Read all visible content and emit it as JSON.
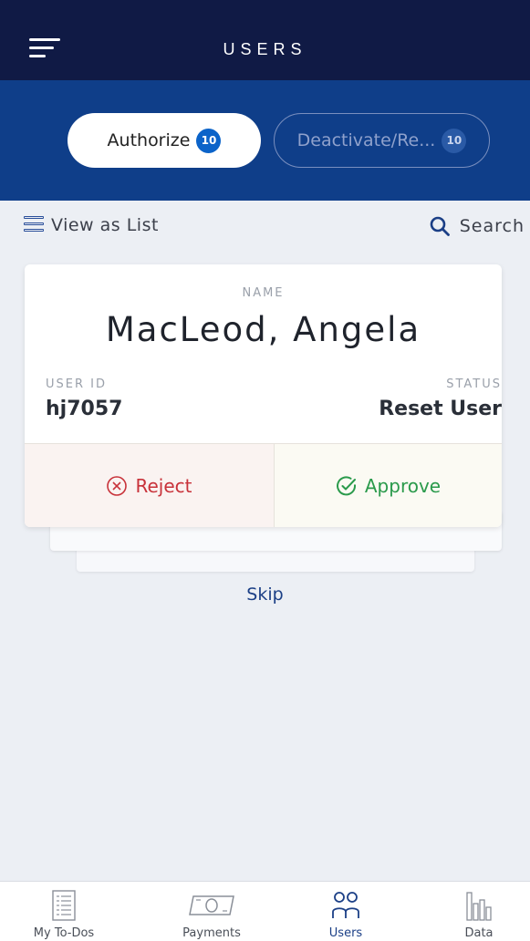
{
  "header": {
    "title": "USERS"
  },
  "tabs": [
    {
      "label": "Authorize",
      "count": "10"
    },
    {
      "label": "Deactivate/Re...",
      "count": "10"
    }
  ],
  "toolbar": {
    "view_label": "View as List",
    "search_label": "Search"
  },
  "card": {
    "name_label": "NAME",
    "name_value": "MacLeod, Angela",
    "userid_label": "USER ID",
    "userid_value": "hj7057",
    "status_label": "STATUS",
    "status_value": "Reset User",
    "reject_label": "Reject",
    "approve_label": "Approve"
  },
  "skip_label": "Skip",
  "bottom_nav": [
    {
      "label": "My To-Dos",
      "icon": "checklist-icon"
    },
    {
      "label": "Payments",
      "icon": "banknote-icon"
    },
    {
      "label": "Users",
      "icon": "users-icon"
    },
    {
      "label": "Data",
      "icon": "bar-chart-icon"
    }
  ],
  "colors": {
    "header_bg": "#101a45",
    "tabbar_bg": "#0f3e89",
    "accent": "#0b63c9",
    "reject": "#c8323a",
    "approve": "#2a9a4b",
    "active_nav": "#1b3f86"
  }
}
